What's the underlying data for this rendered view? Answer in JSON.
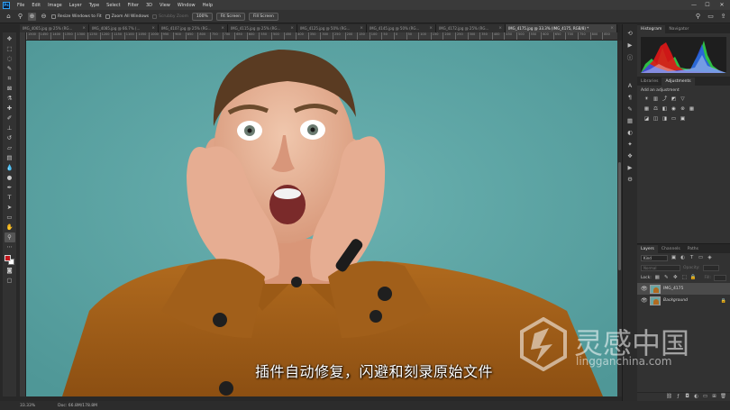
{
  "menubar": {
    "logo": "Ps",
    "items": [
      "File",
      "Edit",
      "Image",
      "Layer",
      "Type",
      "Select",
      "Filter",
      "3D",
      "View",
      "Window",
      "Help"
    ],
    "minimize": "—",
    "maximize": "☐",
    "close": "✕"
  },
  "options": {
    "resize_windows": "Resize Windows to Fit",
    "zoom_all": "Zoom All Windows",
    "scrubby_zoom": "Scrubby Zoom",
    "zoom_100": "100%",
    "fit_screen": "Fit Screen",
    "fill_screen": "Fill Screen"
  },
  "tabs": [
    {
      "label": "IMG_4065.jpg @ 25% (RG...",
      "active": false
    },
    {
      "label": "IMG_4085.jpg @ 66.7% (...",
      "active": false
    },
    {
      "label": "IMG_4107.jpg @ 25% (RG...",
      "active": false
    },
    {
      "label": "IMG_4115.jpg @ 25% (RG...",
      "active": false
    },
    {
      "label": "IMG_4125.jpg @ 50% (RG...",
      "active": false
    },
    {
      "label": "IMG_4145.jpg @ 50% (RG...",
      "active": false
    },
    {
      "label": "IMG_4172.jpg @ 25% (RG...",
      "active": false
    },
    {
      "label": "IMG_4175.jpg @ 33.3% (IMG_4175, RGB/8) *",
      "active": true
    }
  ],
  "ruler_ticks": [
    "1500",
    "1450",
    "1400",
    "1350",
    "1300",
    "1250",
    "1200",
    "1150",
    "1100",
    "1050",
    "1000",
    "950",
    "900",
    "850",
    "800",
    "750",
    "700",
    "650",
    "600",
    "550",
    "500",
    "450",
    "400",
    "350",
    "300",
    "250",
    "200",
    "150",
    "100",
    "50",
    "0",
    "50",
    "100",
    "150",
    "200",
    "250",
    "300",
    "350",
    "400",
    "450",
    "500",
    "550",
    "600",
    "650",
    "700",
    "750",
    "800",
    "850"
  ],
  "status": {
    "zoom": "33.33%",
    "doc": "Doc: 66.8M/178.8M"
  },
  "subtitle": "插件自动修复，闪避和刻录原始文件",
  "panels": {
    "top_tabs": [
      "Histogram",
      "Navigator"
    ],
    "mid_tabs": [
      "Libraries",
      "Adjustments"
    ],
    "adj_title": "Add an adjustment",
    "layer_tabs": [
      "Layers",
      "Channels",
      "Paths"
    ],
    "kind": "Kind",
    "normal": "Normal",
    "opacity": "Opacity:",
    "lock": "Lock:",
    "fill": "Fill:",
    "layers": [
      {
        "name": "IMG_4175",
        "selected": true,
        "italic": false
      },
      {
        "name": "Background",
        "selected": false,
        "italic": true
      }
    ]
  },
  "watermark": {
    "cn": "灵感中国",
    "en": "lingganchina.com"
  },
  "colors": {
    "canvas_bg": "#5fa6a6",
    "foreground": "#c3151b",
    "background": "#ffffff",
    "accent": "#31a8ff"
  }
}
